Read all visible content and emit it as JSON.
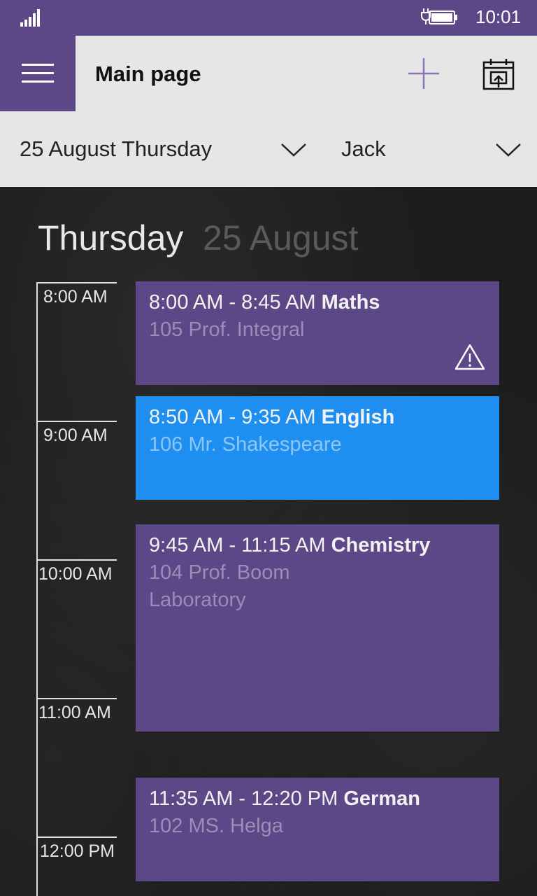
{
  "status": {
    "time": "10:01"
  },
  "header": {
    "title": "Main page"
  },
  "selectors": {
    "date": "25 August Thursday",
    "person": "Jack"
  },
  "day_heading": {
    "weekday": "Thursday",
    "date": "25 August"
  },
  "timeline": [
    "8:00 AM",
    "9:00 AM",
    "10:00 AM",
    "11:00 AM",
    "12:00 PM"
  ],
  "lessons": [
    {
      "time": "8:00 AM - 8:45 AM",
      "subject": "Maths",
      "details": [
        "105 Prof. Integral"
      ],
      "warning": true
    },
    {
      "time": "8:50 AM - 9:35 AM",
      "subject": "English",
      "details": [
        "106 Mr. Shakespeare"
      ]
    },
    {
      "time": "9:45 AM - 11:15 AM",
      "subject": "Chemistry",
      "details": [
        "104 Prof. Boom",
        "Laboratory"
      ]
    },
    {
      "time": "11:35 AM - 12:20 PM",
      "subject": "German",
      "details": [
        "102 MS. Helga"
      ]
    }
  ],
  "colors": {
    "accent": "#5c4886",
    "highlight": "#1e8ff0",
    "bar": "#e6e6e6"
  },
  "icons": [
    "signal-icon",
    "battery-icon",
    "hamburger-menu-icon",
    "add-icon",
    "calendar-export-icon",
    "chevron-down-icon",
    "warning-icon"
  ]
}
